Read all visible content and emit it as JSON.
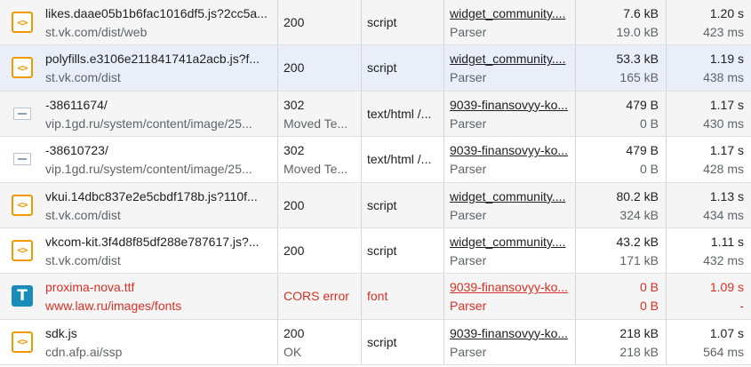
{
  "requests": [
    {
      "icon": "script-file-icon",
      "name": "likes.daae05b1b6fac1016df5.js?2cc5a...",
      "path": "st.vk.com/dist/web",
      "status_code": "200",
      "status_text": "",
      "type": "script",
      "initiator": "widget_community....",
      "initiator_type": "Parser",
      "transferred": "7.6 kB",
      "resource_size": "19.0 kB",
      "time": "1.20 s",
      "latency": "423 ms"
    },
    {
      "icon": "script-file-icon",
      "name": "polyfills.e3106e211841741a2acb.js?f...",
      "path": "st.vk.com/dist",
      "status_code": "200",
      "status_text": "",
      "type": "script",
      "initiator": "widget_community....",
      "initiator_type": "Parser",
      "transferred": "53.3 kB",
      "resource_size": "165 kB",
      "time": "1.19 s",
      "latency": "438 ms"
    },
    {
      "icon": "document-icon",
      "name": "-38611674/",
      "path": "vip.1gd.ru/system/content/image/25...",
      "status_code": "302",
      "status_text": "Moved Te...",
      "type": "text/html /...",
      "initiator": "9039-finansovyy-ko...",
      "initiator_type": "Parser",
      "transferred": "479 B",
      "resource_size": "0 B",
      "time": "1.17 s",
      "latency": "430 ms"
    },
    {
      "icon": "document-icon",
      "name": "-38610723/",
      "path": "vip.1gd.ru/system/content/image/25...",
      "status_code": "302",
      "status_text": "Moved Te...",
      "type": "text/html /...",
      "initiator": "9039-finansovyy-ko...",
      "initiator_type": "Parser",
      "transferred": "479 B",
      "resource_size": "0 B",
      "time": "1.17 s",
      "latency": "428 ms"
    },
    {
      "icon": "script-file-icon",
      "name": "vkui.14dbc837e2e5cbdf178b.js?110f...",
      "path": "st.vk.com/dist",
      "status_code": "200",
      "status_text": "",
      "type": "script",
      "initiator": "widget_community....",
      "initiator_type": "Parser",
      "transferred": "80.2 kB",
      "resource_size": "324 kB",
      "time": "1.13 s",
      "latency": "434 ms"
    },
    {
      "icon": "script-file-icon",
      "name": "vkcom-kit.3f4d8f85df288e787617.js?...",
      "path": "st.vk.com/dist",
      "status_code": "200",
      "status_text": "",
      "type": "script",
      "initiator": "widget_community....",
      "initiator_type": "Parser",
      "transferred": "43.2 kB",
      "resource_size": "171 kB",
      "time": "1.11 s",
      "latency": "432 ms"
    },
    {
      "icon": "font-file-icon",
      "name": "proxima-nova.ttf",
      "path": "www.law.ru/images/fonts",
      "status_code": "CORS error",
      "status_text": "",
      "type": "font",
      "initiator": "9039-finansovyy-ko...",
      "initiator_type": "Parser",
      "transferred": "0 B",
      "resource_size": "0 B",
      "time": "1.09 s",
      "latency": "-"
    },
    {
      "icon": "script-file-icon",
      "name": "sdk.js",
      "path": "cdn.afp.ai/ssp",
      "status_code": "200",
      "status_text": "OK",
      "type": "script",
      "initiator": "9039-finansovyy-ko...",
      "initiator_type": "Parser",
      "transferred": "218 kB",
      "resource_size": "218 kB",
      "time": "1.07 s",
      "latency": "564 ms"
    }
  ],
  "icon_glyphs": {
    "script": "<>",
    "font": "T"
  },
  "colors": {
    "script_icon": "#f29900",
    "font_icon": "#1a8cba",
    "error_text": "#d93025",
    "selected_row": "#e9eef8"
  }
}
